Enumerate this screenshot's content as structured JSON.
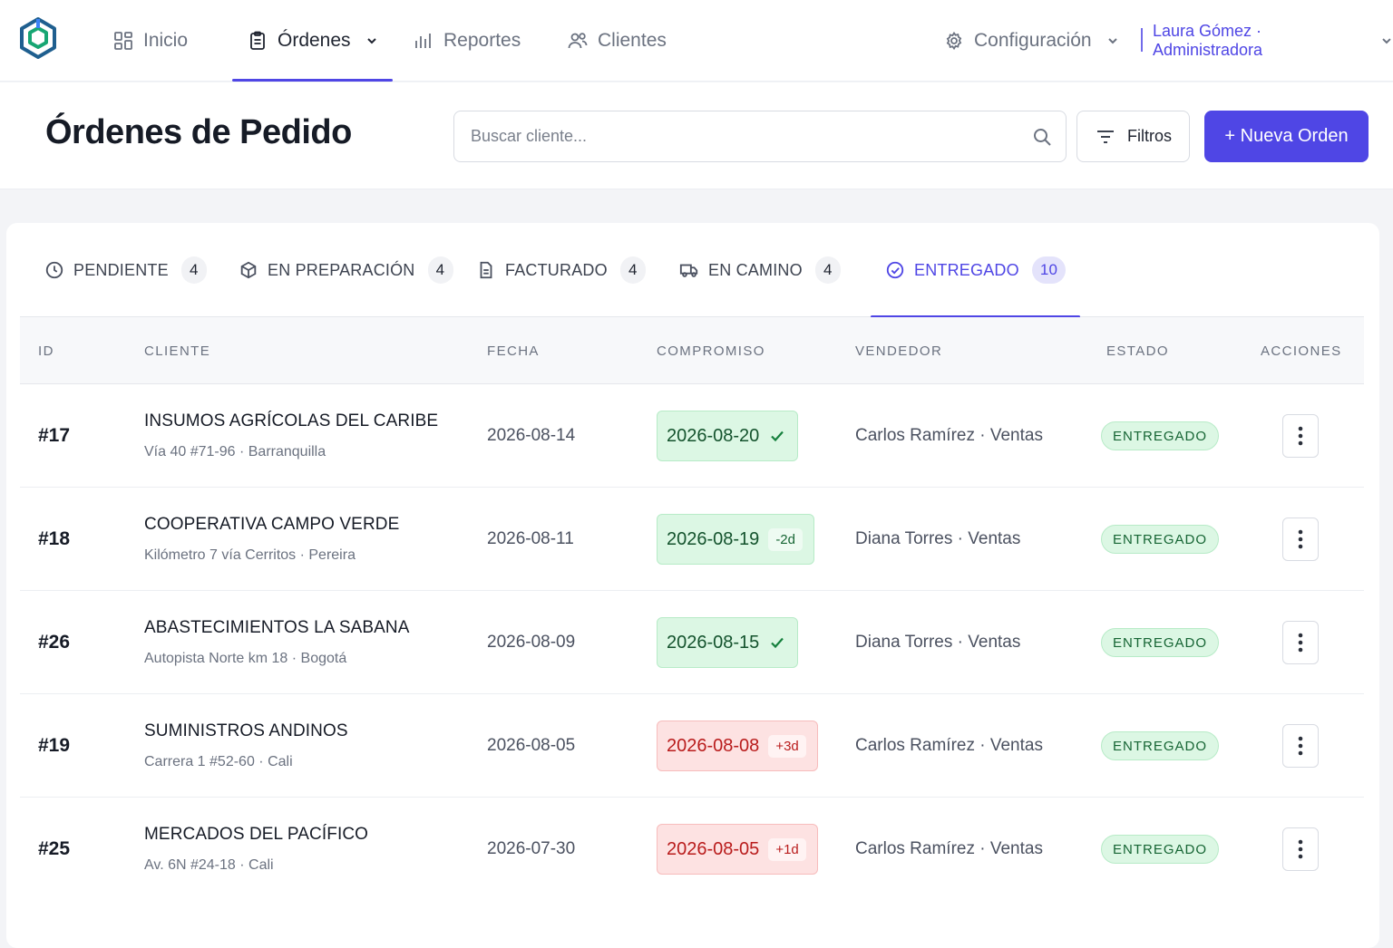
{
  "nav": {
    "items": [
      {
        "label": "Inicio",
        "icon": "grid-icon"
      },
      {
        "label": "Órdenes",
        "icon": "clipboard-icon"
      },
      {
        "label": "Reportes",
        "icon": "bar-chart-icon"
      },
      {
        "label": "Clientes",
        "icon": "users-icon"
      }
    ],
    "settings_label": "Configuración",
    "user_label": "Laura Gómez · Administradora"
  },
  "header": {
    "title": "Órdenes de Pedido",
    "search_placeholder": "Buscar cliente...",
    "filters_label": "Filtros",
    "new_order_label": "+ Nueva Orden"
  },
  "tabs": [
    {
      "label": "PENDIENTE",
      "count": "4",
      "icon": "clock-icon"
    },
    {
      "label": "EN PREPARACIÓN",
      "count": "4",
      "icon": "box-icon"
    },
    {
      "label": "FACTURADO",
      "count": "4",
      "icon": "document-icon"
    },
    {
      "label": "EN CAMINO",
      "count": "4",
      "icon": "truck-icon"
    },
    {
      "label": "ENTREGADO",
      "count": "10",
      "icon": "check-circle-icon"
    }
  ],
  "table": {
    "columns": [
      "ID",
      "CLIENTE",
      "FECHA",
      "COMPROMISO",
      "VENDEDOR",
      "ESTADO",
      "ACCIONES"
    ],
    "rows": [
      {
        "id": "#17",
        "client": "INSUMOS AGRÍCOLAS DEL CARIBE",
        "address": "Vía 40 #71-96 · Barranquilla",
        "date": "2026-08-14",
        "commitment": "2026-08-20",
        "delta": "",
        "vendor": "Carlos Ramírez · Ventas",
        "status": "ENTREGADO"
      },
      {
        "id": "#18",
        "client": "COOPERATIVA CAMPO VERDE",
        "address": "Kilómetro 7 vía Cerritos · Pereira",
        "date": "2026-08-11",
        "commitment": "2026-08-19",
        "delta": "-2d",
        "vendor": "Diana Torres · Ventas",
        "status": "ENTREGADO"
      },
      {
        "id": "#26",
        "client": "ABASTECIMIENTOS LA SABANA",
        "address": "Autopista Norte km 18 · Bogotá",
        "date": "2026-08-09",
        "commitment": "2026-08-15",
        "delta": "",
        "vendor": "Diana Torres · Ventas",
        "status": "ENTREGADO"
      },
      {
        "id": "#19",
        "client": "SUMINISTROS ANDINOS",
        "address": "Carrera 1 #52-60 · Cali",
        "date": "2026-08-05",
        "commitment": "2026-08-08",
        "delta": "+3d",
        "vendor": "Carlos Ramírez · Ventas",
        "status": "ENTREGADO"
      },
      {
        "id": "#25",
        "client": "MERCADOS DEL PACÍFICO",
        "address": "Av. 6N #24-18 · Cali",
        "date": "2026-07-30",
        "commitment": "2026-08-05",
        "delta": "+1d",
        "vendor": "Carlos Ramírez · Ventas",
        "status": "ENTREGADO"
      }
    ]
  },
  "colors": {
    "accent": "#4f46e5",
    "ok_bg": "#dcf7e4",
    "late_bg": "#fde2e2"
  }
}
